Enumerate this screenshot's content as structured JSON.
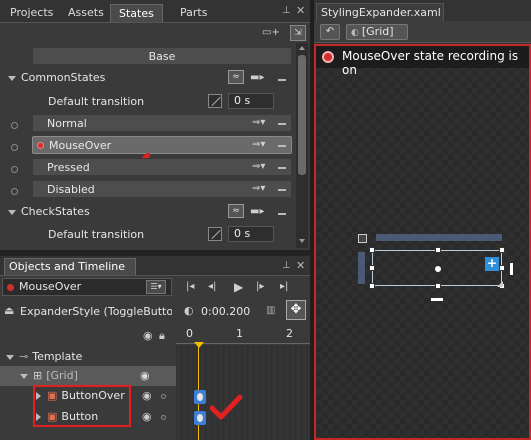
{
  "left_tabs": [
    "Projects",
    "Assets",
    "States",
    "Parts"
  ],
  "states": {
    "base_label": "Base",
    "groups": [
      {
        "name": "CommonStates",
        "default_transition_label": "Default transition",
        "default_transition_value": "0 s",
        "states": [
          "Normal",
          "MouseOver",
          "Pressed",
          "Disabled"
        ]
      },
      {
        "name": "CheckStates",
        "default_transition_label": "Default transition",
        "default_transition_value": "0 s"
      }
    ]
  },
  "objects_panel": {
    "title": "Objects and Timeline",
    "current_state": "MouseOver",
    "style_name": "ExpanderStyle (ToggleButton...",
    "time": "0:00.200",
    "ruler": [
      "0",
      "1",
      "2"
    ],
    "tree": [
      "Template",
      "[Grid]",
      "ButtonOver",
      "Button"
    ]
  },
  "doc": {
    "tab_title": "StylingExpander.xaml",
    "breadcrumb": "[Grid]",
    "recording_text": "MouseOver state recording is on"
  },
  "colors": {
    "record_red": "#d32f2f",
    "annotation_red": "#e32020",
    "selection_blue": "#3d7fd6"
  }
}
